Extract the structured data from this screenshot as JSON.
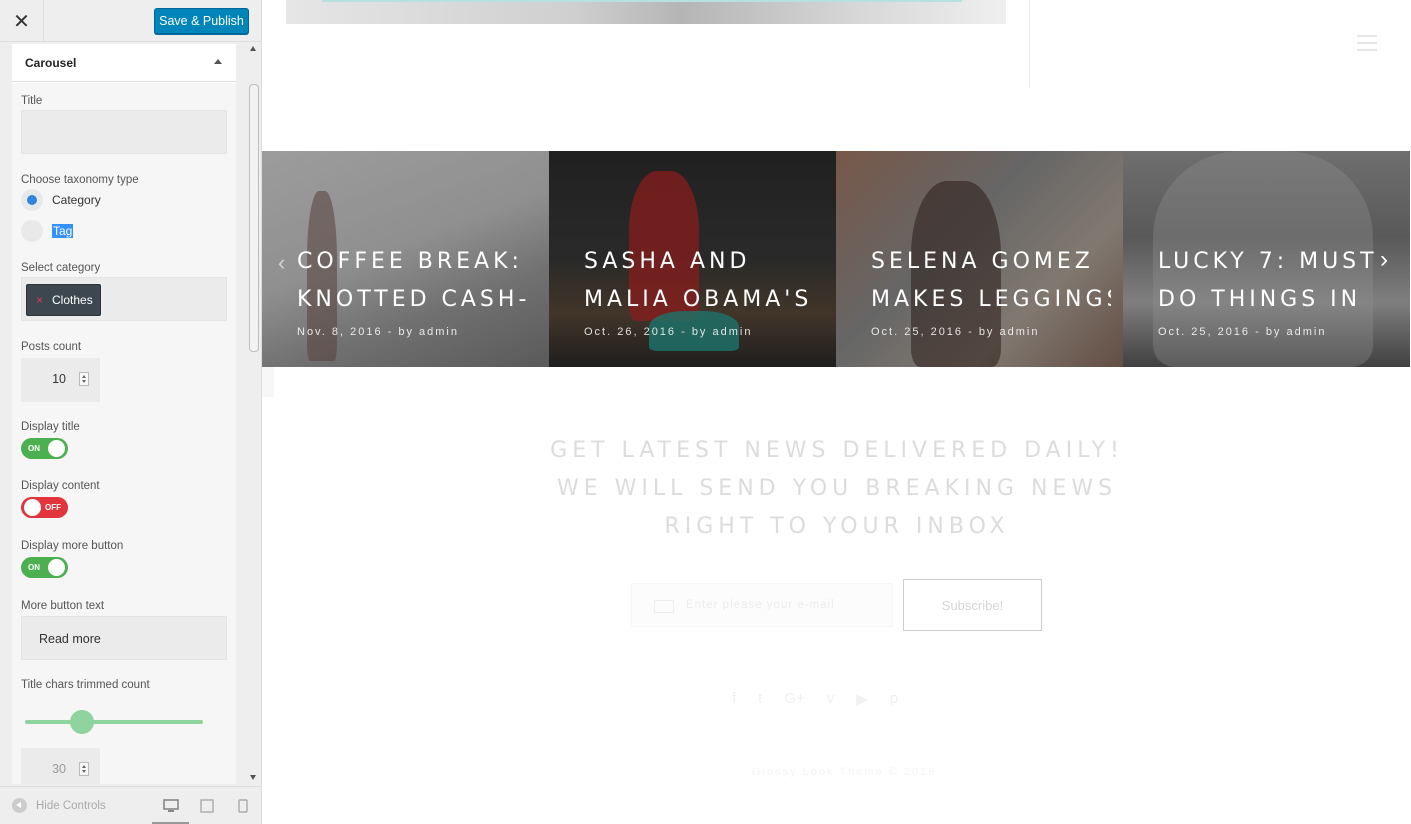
{
  "header": {
    "close_label": "✕",
    "save_label": "Save & Publish"
  },
  "section": {
    "title": "Carousel"
  },
  "fields": {
    "title_label": "Title",
    "title_value": "",
    "taxonomy_label": "Choose taxonomy type",
    "taxonomy_options": [
      "Category",
      "Tag"
    ],
    "category_label": "Select category",
    "category_chip": "Clothes",
    "chip_remove": "×",
    "posts_count_label": "Posts count",
    "posts_count": "10",
    "display_title_label": "Display title",
    "display_content_label": "Display content",
    "display_more_label": "Display more button",
    "more_text_label": "More button text",
    "more_text_value": "Read more",
    "title_chars_label": "Title chars trimmed count",
    "title_chars_value": "30",
    "title_chars_fraction": 0.32
  },
  "toggles": {
    "on": "ON",
    "off": "OFF"
  },
  "footer": {
    "hide_controls": "Hide Controls"
  },
  "carousel": {
    "slides": [
      {
        "title1": "Coffee break:",
        "title2": "knotted cash-",
        "meta": "Nov. 8, 2016  -  by admin"
      },
      {
        "title1": "Sasha and",
        "title2": "Malia Obama's",
        "meta": "Oct. 26, 2016  -  by admin"
      },
      {
        "title1": "Selena Gomez",
        "title2": "makes leggings",
        "meta": "Oct. 25, 2016  -  by admin"
      },
      {
        "title1": "Lucky 7: Must",
        "title2": "do things in",
        "meta": "Oct. 25, 2016  -  by admin"
      }
    ],
    "prev": "‹",
    "next": "›"
  },
  "newsletter": {
    "heading": "GET LATEST NEWS DELIVERED DAILY! WE WILL SEND YOU BREAKING NEWS RIGHT TO YOUR INBOX",
    "email_placeholder": "Enter please your e-mail",
    "subscribe": "Subscribe!"
  },
  "social": [
    "f",
    "t",
    "G+",
    "v",
    "▶",
    "p"
  ],
  "copyright": "Glossy Look Theme © 2016",
  "colors": {
    "accent": "#0085ba",
    "toggle_on": "#4caf50",
    "toggle_off": "#e2343d",
    "radio": "#2e86de"
  }
}
